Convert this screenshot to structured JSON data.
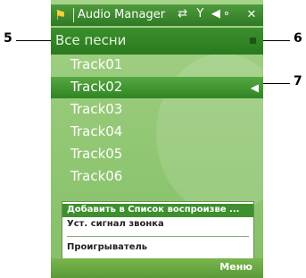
{
  "window": {
    "title": "Audio Manager",
    "status_icons": "⇄ Y ◀∘",
    "close": "✕"
  },
  "header": {
    "label": "Все песни"
  },
  "tracks": [
    {
      "label": "Track01"
    },
    {
      "label": "Track02",
      "selected": true
    },
    {
      "label": "Track03"
    },
    {
      "label": "Track04"
    },
    {
      "label": "Track05"
    },
    {
      "label": "Track06"
    }
  ],
  "context_menu": {
    "items": [
      {
        "label": "Добавить в Список воспроизве ..."
      },
      {
        "label": "Уст. сигнал звонка"
      },
      {
        "label": "Проигрыватель"
      }
    ]
  },
  "softkeys": {
    "right": "Меню"
  },
  "callouts": {
    "c5": "5",
    "c6": "6",
    "c7": "7"
  },
  "colors": {
    "accent": "#3e8f2d",
    "background": "#95c977"
  }
}
